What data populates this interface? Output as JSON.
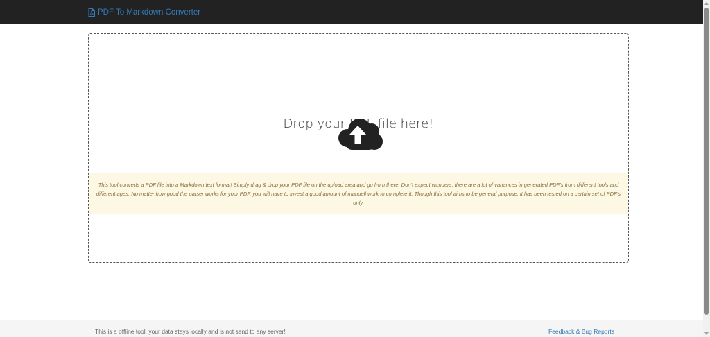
{
  "navbar": {
    "brand_label": "PDF To Markdown Converter",
    "brand_icon": "pdf-file-icon",
    "brand_color": "#337ab7",
    "background": "#222222"
  },
  "dropzone": {
    "title": "Drop your PDF file here!",
    "icon": "cloud-upload-icon",
    "notice": "This tool converts a PDF file into a Markdown text format! Simply drag & drop your PDF file on the upload area and go from there. Don't expect wonders, there are a lot of variances in generated PDF's from different tools and different ages. No matter how good the parser works for your PDF, you will have to invest a good amount of manuell work to complete it. Though this tool aims to be general purpose, it has been tested on a certain set of PDF's only."
  },
  "footer": {
    "privacy_text": "This is a offline tool, your data stays locally and is not send to any server!",
    "feedback_label": "Feedback & Bug Reports"
  }
}
